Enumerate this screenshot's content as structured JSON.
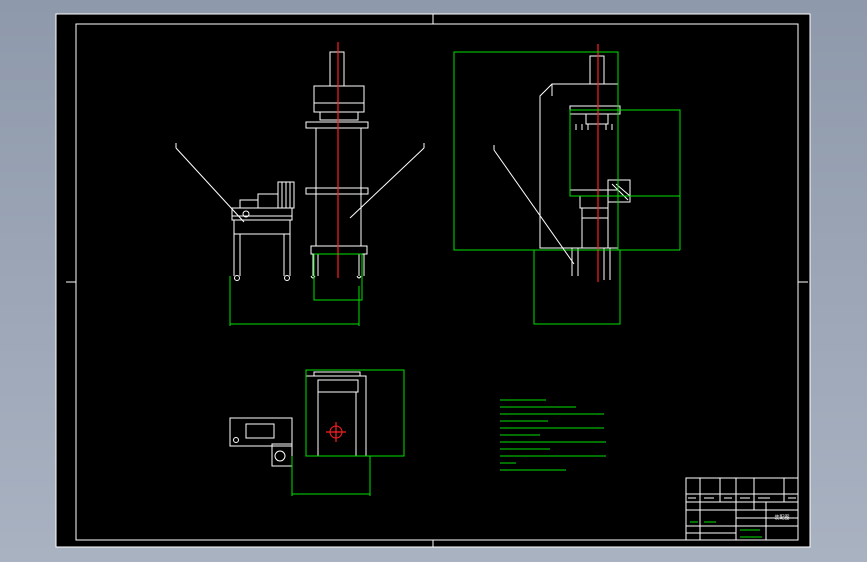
{
  "drawing": {
    "background": "#000000",
    "line_color": "#ffffff",
    "dimension_color": "#00e000",
    "centerline_color": "#ff2020"
  },
  "title_block": {
    "drawing_name": "装配图"
  }
}
